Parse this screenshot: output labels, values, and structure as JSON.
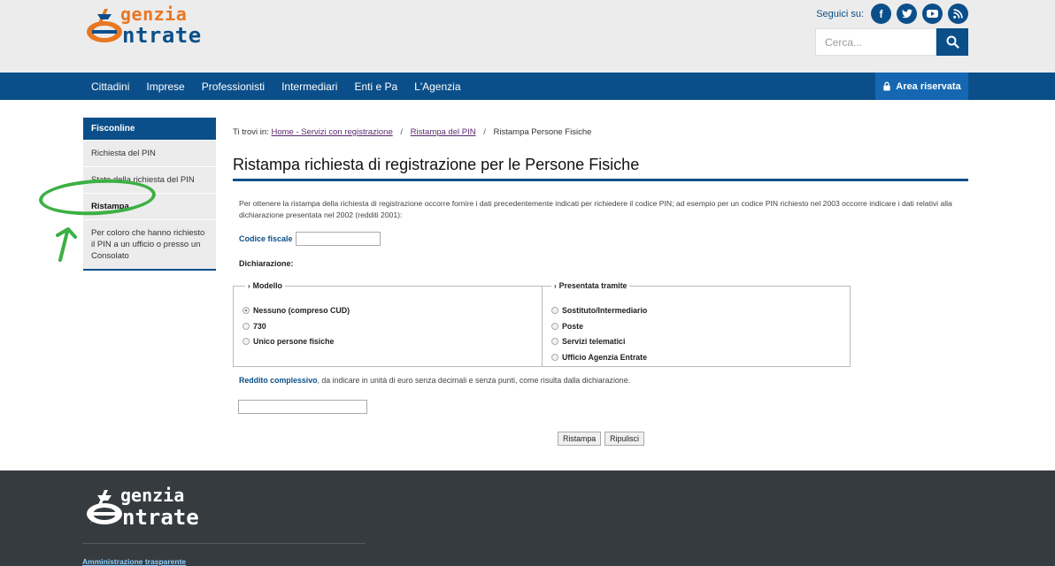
{
  "header": {
    "logo_line1": "genzia",
    "logo_line2": "ntrate",
    "social_label": "Seguici su:",
    "social_icons": [
      "facebook-icon",
      "twitter-icon",
      "youtube-icon",
      "rss-icon"
    ],
    "search_placeholder": "Cerca..."
  },
  "nav": {
    "items": [
      "Cittadini",
      "Imprese",
      "Professionisti",
      "Intermediari",
      "Enti e Pa",
      "L'Agenzia"
    ],
    "area_riservata": "Area riservata"
  },
  "sidebar": {
    "title": "Fisconline",
    "items": [
      "Richiesta del PIN",
      "Stato della richiesta del PIN",
      "Ristampa",
      "Per coloro che hanno richiesto il PIN a un ufficio o presso un Consolato"
    ],
    "active_index": 2
  },
  "breadcrumb": {
    "prefix": "Ti trovi in:",
    "links": [
      "Home - Servizi con registrazione",
      "Ristampa del PIN"
    ],
    "current": "Ristampa Persone Fisiche"
  },
  "main": {
    "title": "Ristampa richiesta di registrazione per le Persone Fisiche",
    "intro": "Per ottenere la ristampa della richiesta di registrazione occorre fornire i dati precedentemente indicati per richiedere il codice PIN; ad esempio per un codice PIN richiesto nel 2003 occorre indicare i dati relativi alla dichiarazione presentata nel 2002 (redditi 2001):",
    "codice_fiscale_label": "Codice fiscale",
    "codice_fiscale_value": "",
    "dichiarazione_label": "Dichiarazione:",
    "modello": {
      "legend": "Modello",
      "options": [
        "Nessuno (compreso CUD)",
        "730",
        "Unico persone fisiche"
      ],
      "selected": "Nessuno (compreso CUD)"
    },
    "presentata": {
      "legend": "Presentata tramite",
      "options": [
        "Sostituto/Intermediario",
        "Poste",
        "Servizi telematici",
        "Ufficio Agenzia Entrate"
      ],
      "selected": null
    },
    "reddito_bold": "Reddito complessivo",
    "reddito_text": ", da indicare in unità di euro senza decimali e senza punti, come risulta dalla dichiarazione.",
    "reddito_value": "",
    "btn_ristampa": "Ristampa",
    "btn_ripulisci": "Ripulisci"
  },
  "footer": {
    "logo_line1": "genzia",
    "logo_line2": "ntrate",
    "link": "Amministrazione trasparente"
  },
  "colors": {
    "brand_blue": "#0b4f8a",
    "brand_orange": "#e87722",
    "annotation_green": "#3cb043",
    "footer_bg": "#363b40"
  }
}
